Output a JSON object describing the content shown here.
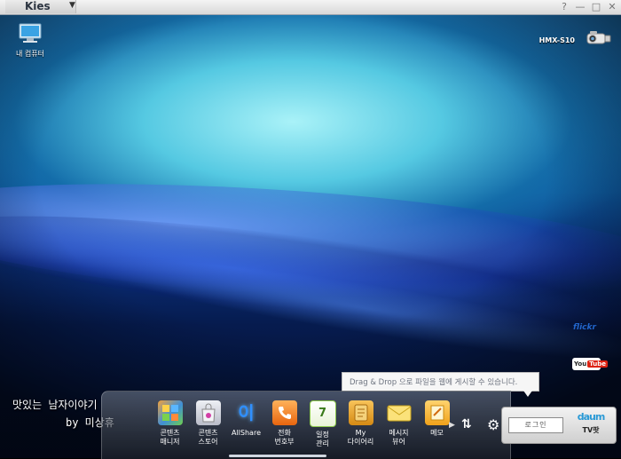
{
  "window": {
    "app_name": "Kies",
    "menu_arrow": "▼",
    "controls": [
      "help-icon",
      "minimize-icon",
      "maximize-icon",
      "close-icon"
    ],
    "control_glyphs": [
      "?",
      "—",
      "□",
      "✕"
    ]
  },
  "desktop": {
    "my_computer_label": "내 컴퓨터",
    "device_name": "HMX-S10",
    "services": [
      "flickr",
      "YouTube"
    ],
    "flickr_text": "flickr",
    "youtube_left": "You",
    "youtube_right": "Tube"
  },
  "watermark": {
    "line1": "맛있는 남자이야기",
    "line2": "by 미상휴"
  },
  "tooltip": "Drag & Drop 으로 파일을 웹에 게시할 수 있습니다.",
  "dock": {
    "items": [
      {
        "name": "content-manager",
        "label1": "콘텐츠",
        "label2": "매니저",
        "icon": "content-manager-icon",
        "color": "#3f8fd8"
      },
      {
        "name": "content-store",
        "label1": "콘텐츠",
        "label2": "스토어",
        "icon": "store-bag-icon",
        "color": "#d6d6de"
      },
      {
        "name": "allshare",
        "label1": "AllShare",
        "label2": "",
        "icon": "allshare-icon",
        "color": "#1b6fd1"
      },
      {
        "name": "phonebook",
        "label1": "전화",
        "label2": "번호부",
        "icon": "phone-icon",
        "color": "#f07a1a"
      },
      {
        "name": "schedule",
        "label1": "일정",
        "label2": "관리",
        "icon": "calendar-icon",
        "color": "#8ed14a"
      },
      {
        "name": "my-diary",
        "label1": "My",
        "label2": "다이어리",
        "icon": "diary-icon",
        "color": "#e9a21f"
      },
      {
        "name": "message-viewer",
        "label1": "메시지",
        "label2": "뷰어",
        "icon": "envelope-icon",
        "color": "#f3d45a"
      },
      {
        "name": "memo",
        "label1": "메모",
        "label2": "",
        "icon": "memo-icon",
        "color": "#f2b640"
      }
    ],
    "allshare_glyph": "이",
    "calendar_day": "7",
    "more_arrow": "▶",
    "transfer_glyph": "⇅",
    "settings_glyph": "⚙"
  },
  "login": {
    "button_label": "로그인",
    "tvpot_logo": "daum",
    "tvpot_label": "TV팟"
  }
}
